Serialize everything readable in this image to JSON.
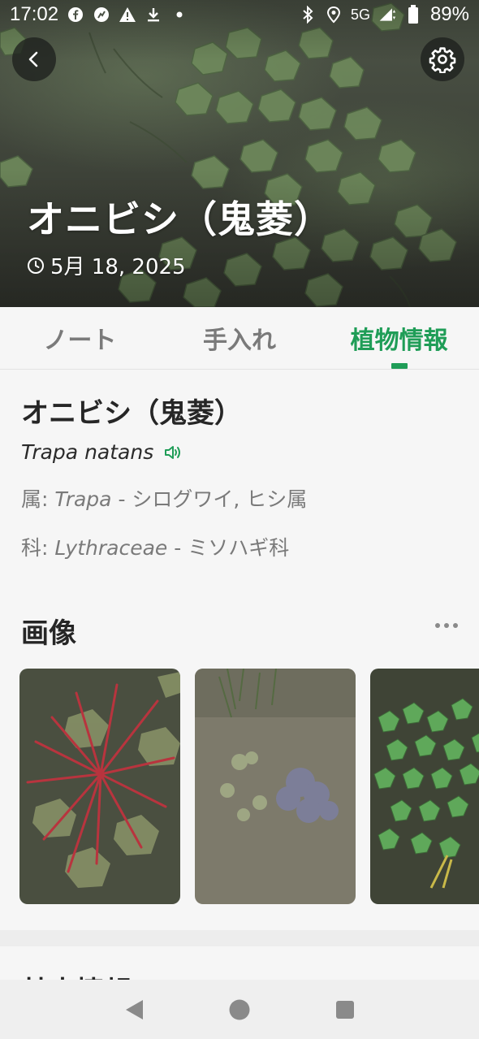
{
  "status_bar": {
    "time": "17:02",
    "network": "5G",
    "battery": "89%",
    "icons": [
      "facebook-icon",
      "activity-icon",
      "warning-icon",
      "download-icon",
      "dot-icon",
      "bluetooth-icon",
      "location-icon",
      "signal-icon",
      "battery-icon"
    ]
  },
  "header": {
    "title": "オニビシ（鬼菱）",
    "date": "5月 18, 2025",
    "back_icon": "chevron-left-icon",
    "settings_icon": "gear-icon"
  },
  "tabs": [
    {
      "label": "ノート",
      "active": false
    },
    {
      "label": "手入れ",
      "active": false
    },
    {
      "label": "植物情報",
      "active": true
    }
  ],
  "plant_info": {
    "name": "オニビシ（鬼菱）",
    "scientific_name": "Trapa natans",
    "genus": {
      "prefix": "属: ",
      "latin": "Trapa",
      "suffix": " - シログワイ, ヒシ属"
    },
    "family": {
      "prefix": "科: ",
      "latin": "Lythraceae",
      "suffix": " - ミソハギ科"
    }
  },
  "images_section": {
    "title": "画像",
    "more_icon": "more-horizontal-icon",
    "photos": [
      {
        "subject": "red-stemmed water chestnut rosette"
      },
      {
        "subject": "small rosette in shallow water"
      },
      {
        "subject": "floating water chestnut leaves"
      }
    ]
  },
  "next_section": {
    "title": "基本情報"
  },
  "colors": {
    "accent": "#1f9d57",
    "text_primary": "#262626",
    "text_secondary": "#7a7a7a",
    "card_bg": "#f6f6f6",
    "page_bg": "#ededed"
  },
  "nav_bar": {
    "back_icon": "triangle-back-icon",
    "home_icon": "circle-home-icon",
    "recents_icon": "square-recents-icon"
  }
}
